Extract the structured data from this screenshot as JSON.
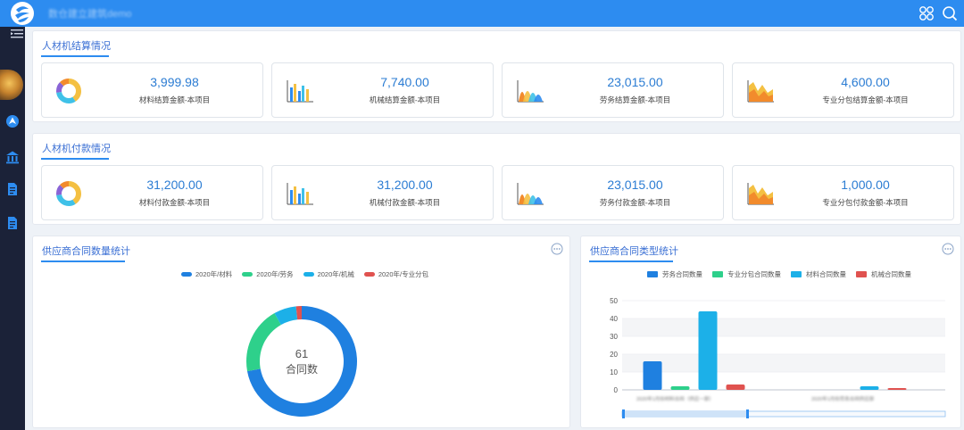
{
  "header": {
    "title": "数仓建立建筑demo"
  },
  "icons": {
    "apps": "apps-grid-icon",
    "search": "search-icon",
    "menu": "collapse-menu-icon"
  },
  "colors": {
    "brand": "#2d8cf0",
    "sidebar": "#1b2238",
    "value_text": "#2b7cd3",
    "series_blue": "#1f80e0",
    "series_green": "#2ed08b",
    "series_cyan": "#1cb0e8",
    "series_red": "#e0524f"
  },
  "settlement": {
    "title": "人材机结算情况",
    "cards": [
      {
        "value": "3,999.98",
        "label": "材料结算金额-本项目",
        "icon": "donut-chart-icon"
      },
      {
        "value": "7,740.00",
        "label": "机械结算金额-本项目",
        "icon": "bar-chart-icon"
      },
      {
        "value": "23,015.00",
        "label": "劳务结算金额-本项目",
        "icon": "peak-chart-icon"
      },
      {
        "value": "4,600.00",
        "label": "专业分包结算金额-本项目",
        "icon": "area-chart-icon"
      }
    ]
  },
  "payment": {
    "title": "人材机付款情况",
    "cards": [
      {
        "value": "31,200.00",
        "label": "材料付款金额-本项目",
        "icon": "donut-chart-icon"
      },
      {
        "value": "31,200.00",
        "label": "机械付款金额-本项目",
        "icon": "bar-chart-icon"
      },
      {
        "value": "23,015.00",
        "label": "劳务付款金额-本项目",
        "icon": "peak-chart-icon"
      },
      {
        "value": "1,000.00",
        "label": "专业分包付款金额-本项目",
        "icon": "area-chart-icon"
      }
    ]
  },
  "contract_count": {
    "title": "供应商合同数量统计",
    "center_value": "61",
    "center_label": "合同数"
  },
  "contract_type": {
    "title": "供应商合同类型统计",
    "group_labels": [
      "2020年1月份材料合同（供应一部）",
      "2020年1月份劳务合同供应部"
    ]
  },
  "chart_data": [
    {
      "type": "pie",
      "legend_position": "top",
      "series": [
        {
          "name": "2020年/材料",
          "value": 44
        },
        {
          "name": "2020年/劳务",
          "value": 12
        },
        {
          "name": "2020年/机械",
          "value": 4
        },
        {
          "name": "2020年/专业分包",
          "value": 1
        }
      ],
      "total": 61
    },
    {
      "type": "bar",
      "legend_position": "top",
      "categories": [
        "group-1",
        "group-2"
      ],
      "series": [
        {
          "name": "劳务合同数量",
          "values": [
            16,
            0
          ]
        },
        {
          "name": "专业分包合同数量",
          "values": [
            2,
            0
          ]
        },
        {
          "name": "材料合同数量",
          "values": [
            44,
            2
          ]
        },
        {
          "name": "机械合同数量",
          "values": [
            3,
            1
          ]
        }
      ],
      "y_ticks": [
        0,
        10,
        20,
        30,
        40,
        50
      ],
      "ylim": [
        0,
        50
      ],
      "grid": true
    }
  ]
}
